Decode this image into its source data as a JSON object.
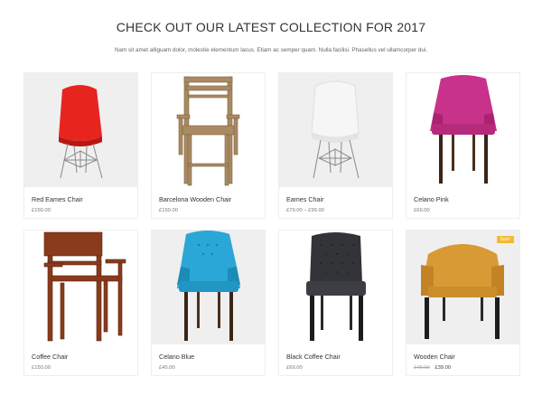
{
  "header": {
    "title": "CHECK OUT OUR LATEST COLLECTION FOR 2017",
    "subtitle": "Nam sit amet alliguam dolor, molestie elementum lacus. Etiam ac semper quam. Nulla facilisi. Phasellus vel ullamcorper dui."
  },
  "products": [
    {
      "name": "Red Eames Chair",
      "price": "£150.00"
    },
    {
      "name": "Barcelona Wooden Chair",
      "price": "£150.00"
    },
    {
      "name": "Eames Chair",
      "price": "£79.00 – £99.00"
    },
    {
      "name": "Celano Pink",
      "price": "£69.00"
    },
    {
      "name": "Coffee Chair",
      "price": "£150.00"
    },
    {
      "name": "Celano Blue",
      "price": "£45.00"
    },
    {
      "name": "Black Coffee Chair",
      "price": "£69.00"
    },
    {
      "name": "Wooden Chair",
      "old_price": "£45.00",
      "price": "£39.00",
      "badge": "Sale!"
    }
  ],
  "colors": {
    "red": "#e8241f",
    "pink": "#c8328a",
    "blue": "#2aa7d6",
    "black": "#333438",
    "mustard": "#d89a35",
    "wood": "#8a3b1c",
    "oak": "#a98a62",
    "sale": "#f5b82e"
  }
}
